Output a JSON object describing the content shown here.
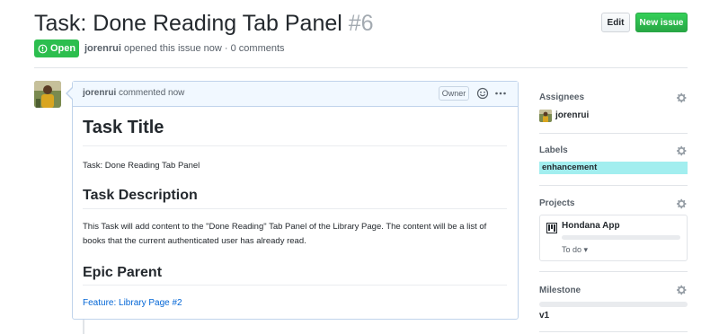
{
  "issue": {
    "title": "Task: Done Reading Tab Panel",
    "number": "#6",
    "state": "Open",
    "author": "jorenrui",
    "opened_text": " opened this issue now · 0 comments"
  },
  "header_buttons": {
    "edit": "Edit",
    "new_issue": "New issue"
  },
  "comment": {
    "author": "jorenrui",
    "timestamp_text": " commented now",
    "owner_label": "Owner",
    "body": {
      "h1": "Task Title",
      "p1": "Task: Done Reading Tab Panel",
      "h2_description": "Task Description",
      "p2": "This Task will add content to the \"Done Reading\" Tab Panel of the Library Page. The content will be a list of books that the current authenticated user has already read.",
      "h2_epic": "Epic Parent",
      "link": "Feature: Library Page #2"
    }
  },
  "sidebar": {
    "assignees": {
      "label": "Assignees",
      "user": "jorenrui"
    },
    "labels": {
      "label": "Labels",
      "chip": "enhancement",
      "chip_color": "#a2eeef"
    },
    "projects": {
      "label": "Projects",
      "name": "Hondana App",
      "column": "To do",
      "progress": 0
    },
    "milestone": {
      "label": "Milestone",
      "name": "v1",
      "progress": 0
    }
  },
  "colors": {
    "open_green": "#2cbe4e",
    "new_issue_green": "#28a745",
    "link_blue": "#0366d6",
    "comment_header_bg": "#f1f8ff"
  }
}
